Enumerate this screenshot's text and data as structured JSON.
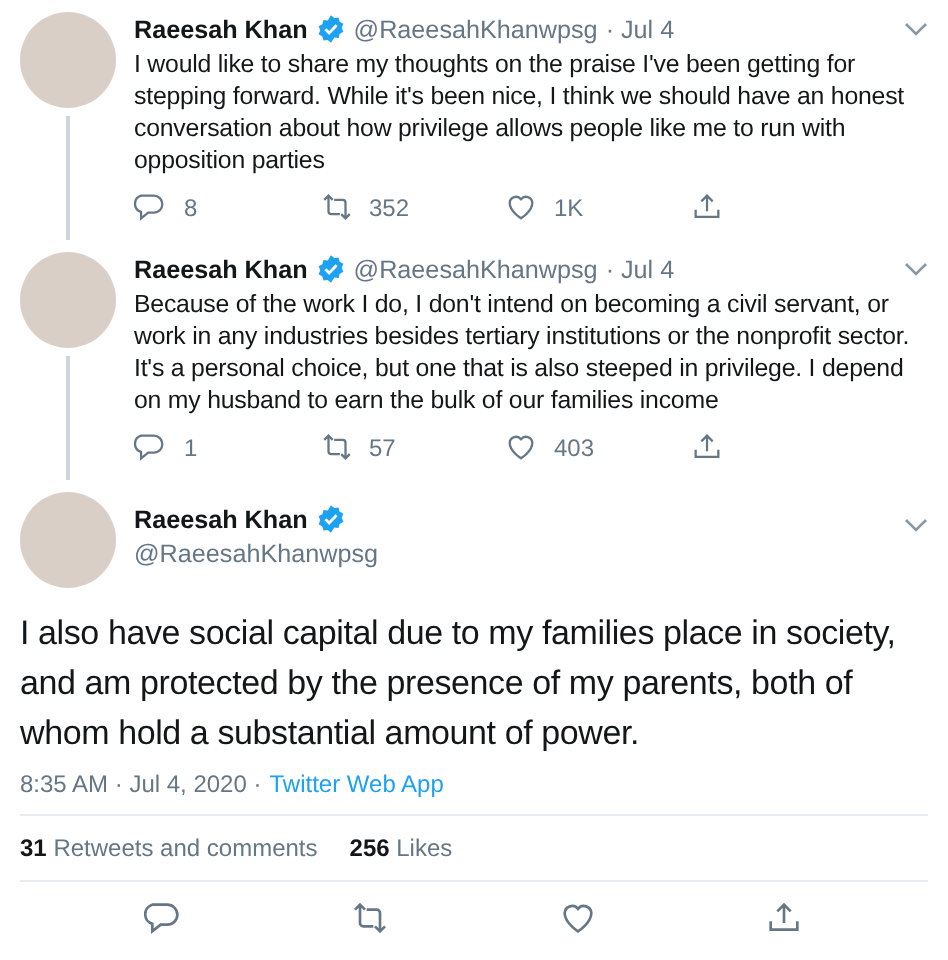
{
  "thread": [
    {
      "name": "Raeesah Khan",
      "handle": "@RaeesahKhanwpsg",
      "date": "· Jul 4",
      "text": "I would like to share my thoughts on the praise I've been getting for stepping forward. While it's been nice, I think we should have an honest conversation about how privilege allows people like me to run with opposition parties",
      "replies": "8",
      "retweets": "352",
      "likes": "1K"
    },
    {
      "name": "Raeesah Khan",
      "handle": "@RaeesahKhanwpsg",
      "date": "· Jul 4",
      "text": "Because of the work I do, I don't intend on becoming a civil servant, or work in any industries besides tertiary institutions or the nonprofit sector. It's a personal choice, but one that is also steeped in privilege. I depend on my husband to earn the bulk of our families income",
      "replies": "1",
      "retweets": "57",
      "likes": "403"
    }
  ],
  "main": {
    "name": "Raeesah Khan",
    "handle": "@RaeesahKhanwpsg",
    "text": "I also have social capital due to my families place in society, and am protected by the presence of my parents, both of whom hold a substantial amount of power.",
    "time": "8:35 AM · Jul 4, 2020 ·",
    "source": "Twitter Web App",
    "stats": [
      "**31** Retweets and comments",
      "**256** Likes"
    ]
  }
}
